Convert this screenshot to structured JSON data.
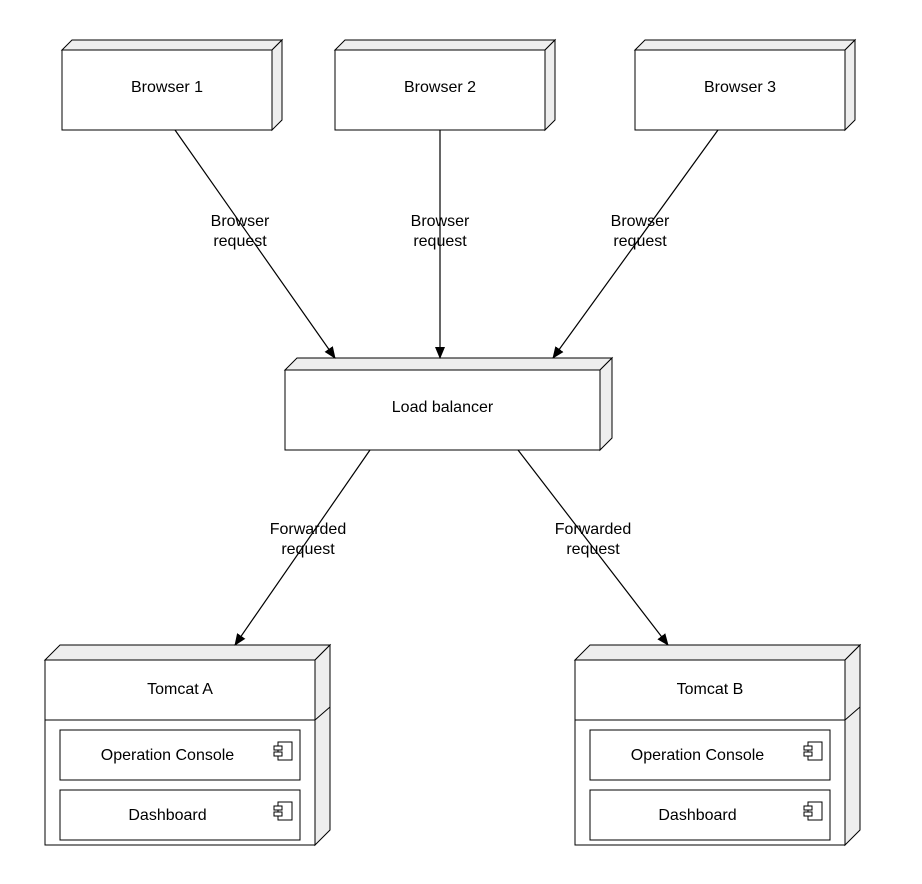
{
  "nodes": {
    "browser1": "Browser 1",
    "browser2": "Browser 2",
    "browser3": "Browser 3",
    "loadBalancer": "Load balancer",
    "tomcatA": "Tomcat A",
    "tomcatB": "Tomcat B",
    "opConsoleA": "Operation Console",
    "dashboardA": "Dashboard",
    "opConsoleB": "Operation Console",
    "dashboardB": "Dashboard"
  },
  "edges": {
    "browserRequest1": "Browser\nrequest",
    "browserRequest2": "Browser\nrequest",
    "browserRequest3": "Browser\nrequest",
    "forwardedRequest1": "Forwarded\nrequest",
    "forwardedRequest2": "Forwarded\nrequest"
  }
}
